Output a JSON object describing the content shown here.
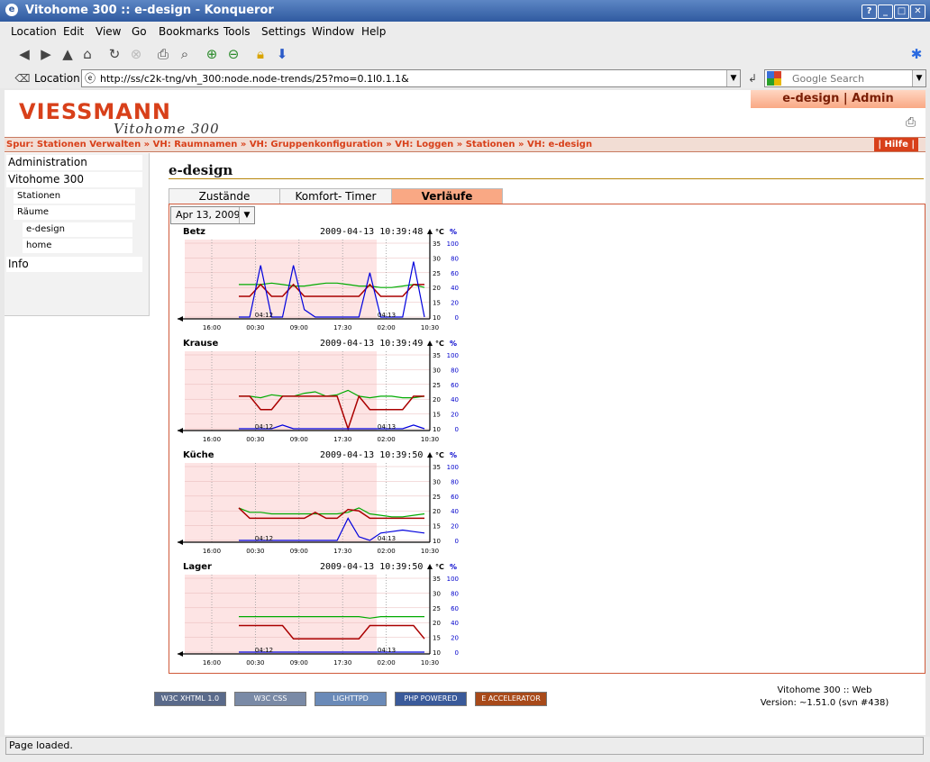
{
  "window": {
    "title": "Vitohome 300 :: e-design - Konqueror",
    "buttons": [
      "?",
      "_",
      "□",
      "✕"
    ]
  },
  "menu": [
    "Location",
    "Edit",
    "View",
    "Go",
    "Bookmarks",
    "Tools",
    "Settings",
    "Window",
    "Help"
  ],
  "location": {
    "label": "Location:",
    "url": "http://ss/c2k-tng/vh_300:node.node-trends/25?mo=0.1l0.1.1&",
    "search_placeholder": "Google Search"
  },
  "site": {
    "brand": "VIESSMANN",
    "product": "Vitohome 300",
    "user": "e-design | Admin",
    "breadcrumb": "Spur: Stationen Verwalten » VH: Raumnamen » VH: Gruppenkonfiguration » VH: Loggen » Stationen » VH: e-design",
    "help": "| Hilfe |"
  },
  "sidebar": {
    "items": [
      {
        "label": "Administration",
        "level": 0
      },
      {
        "label": "Vitohome 300",
        "level": 0
      },
      {
        "label": "Stationen",
        "level": 1
      },
      {
        "label": "Räume",
        "level": 1
      },
      {
        "label": "e-design",
        "level": 2
      },
      {
        "label": "home",
        "level": 2
      },
      {
        "label": "Info",
        "level": 0
      }
    ]
  },
  "content": {
    "title": "e-design",
    "tabs": [
      "Zustände",
      "Komfort- Timer",
      "Verläufe"
    ],
    "active_tab": 2,
    "date": "Apr 13, 2009"
  },
  "chart_data": [
    {
      "type": "line",
      "title": "Betz",
      "timestamp": "2009-04-13 10:39:48",
      "x_ticks": [
        "16:00",
        "00:30",
        "09:00",
        "17:30",
        "02:00",
        "10:30"
      ],
      "date_marks": [
        "04:12",
        "04:13"
      ],
      "y_left_unit": "°C",
      "y_left_ticks": [
        10,
        15,
        20,
        25,
        30,
        35
      ],
      "y_right_unit": "%",
      "y_right_ticks": [
        0,
        20,
        40,
        60,
        80,
        100
      ],
      "series": [
        {
          "color": "#00aa00",
          "values": [
            21,
            21,
            21,
            21.5,
            21,
            20.5,
            20.5,
            21,
            21.5,
            21.5,
            21,
            20.5,
            20.5,
            20,
            20,
            20.5,
            21,
            20
          ]
        },
        {
          "color": "#aa0000",
          "values": [
            17,
            17,
            21,
            17,
            17,
            21,
            17,
            17,
            17,
            17,
            17,
            17,
            21,
            17,
            17,
            17,
            21,
            21
          ]
        },
        {
          "color": "#0000dd",
          "values": [
            0,
            0,
            70,
            0,
            0,
            70,
            10,
            0,
            0,
            0,
            0,
            0,
            60,
            0,
            0,
            0,
            75,
            0
          ]
        }
      ]
    },
    {
      "type": "line",
      "title": "Krause",
      "timestamp": "2009-04-13 10:39:49",
      "x_ticks": [
        "16:00",
        "00:30",
        "09:00",
        "17:30",
        "02:00",
        "10:30"
      ],
      "date_marks": [
        "04:12",
        "04:13"
      ],
      "y_left_unit": "°C",
      "y_left_ticks": [
        10,
        15,
        20,
        25,
        30,
        35
      ],
      "y_right_unit": "%",
      "y_right_ticks": [
        0,
        20,
        40,
        60,
        80,
        100
      ],
      "series": [
        {
          "color": "#00aa00",
          "values": [
            21,
            21,
            20.5,
            21.5,
            21,
            21,
            22,
            22.5,
            21,
            21.5,
            23,
            21,
            20.5,
            21,
            21,
            20.5,
            20.5,
            21
          ]
        },
        {
          "color": "#aa0000",
          "values": [
            21,
            21,
            16.5,
            16.5,
            21,
            21,
            21,
            21,
            21,
            21,
            10,
            21,
            16.5,
            16.5,
            16.5,
            16.5,
            21,
            21
          ]
        },
        {
          "color": "#0000dd",
          "values": [
            0,
            0,
            0,
            0,
            5,
            0,
            0,
            0,
            0,
            0,
            0,
            0,
            0,
            0,
            0,
            0,
            5,
            0
          ]
        }
      ]
    },
    {
      "type": "line",
      "title": "Küche",
      "timestamp": "2009-04-13 10:39:50",
      "x_ticks": [
        "16:00",
        "00:30",
        "09:00",
        "17:30",
        "02:00",
        "10:30"
      ],
      "date_marks": [
        "04:12",
        "04:13"
      ],
      "y_left_unit": "°C",
      "y_left_ticks": [
        10,
        15,
        20,
        25,
        30,
        35
      ],
      "y_right_unit": "%",
      "y_right_ticks": [
        0,
        20,
        40,
        60,
        80,
        100
      ],
      "series": [
        {
          "color": "#00aa00",
          "values": [
            21,
            19.5,
            19.5,
            19,
            19,
            19,
            19,
            19,
            19,
            19,
            19.5,
            21,
            19,
            18.5,
            18,
            18,
            18.5,
            19
          ]
        },
        {
          "color": "#aa0000",
          "values": [
            21,
            17.5,
            17.5,
            17.5,
            17.5,
            17.5,
            17.5,
            19.5,
            17.5,
            17.5,
            20.5,
            20,
            17.5,
            17.5,
            17.5,
            17.5,
            17.5,
            17.5
          ]
        },
        {
          "color": "#0000dd",
          "values": [
            0,
            0,
            0,
            0,
            0,
            0,
            0,
            0,
            0,
            0,
            30,
            5,
            0,
            10,
            12,
            14,
            12,
            10
          ]
        }
      ]
    },
    {
      "type": "line",
      "title": "Lager",
      "timestamp": "2009-04-13 10:39:50",
      "x_ticks": [
        "16:00",
        "00:30",
        "09:00",
        "17:30",
        "02:00",
        "10:30"
      ],
      "date_marks": [
        "04:12",
        "04:13"
      ],
      "y_left_unit": "°C",
      "y_left_ticks": [
        10,
        15,
        20,
        25,
        30,
        35
      ],
      "y_right_unit": "%",
      "y_right_ticks": [
        0,
        20,
        40,
        60,
        80,
        100
      ],
      "series": [
        {
          "color": "#00aa00",
          "values": [
            22,
            22,
            22,
            22,
            22,
            22,
            22,
            22,
            22,
            22,
            22,
            22,
            21.5,
            22,
            22,
            22,
            22,
            22
          ]
        },
        {
          "color": "#aa0000",
          "values": [
            19,
            19,
            19,
            19,
            19,
            14.5,
            14.5,
            14.5,
            14.5,
            14.5,
            14.5,
            14.5,
            19,
            19,
            19,
            19,
            19,
            14.5
          ]
        },
        {
          "color": "#0000dd",
          "values": [
            0,
            0,
            0,
            0,
            0,
            0,
            0,
            0,
            0,
            0,
            0,
            0,
            0,
            0,
            0,
            0,
            0,
            0
          ]
        }
      ]
    }
  ],
  "footer": {
    "badges": [
      "W3C XHTML 1.0",
      "W3C CSS",
      "LIGHTTPD",
      "PHP POWERED",
      "E ACCELERATOR"
    ],
    "app": "Vitohome 300 :: Web",
    "version": "Version: ~1.51.0 (svn #438)"
  },
  "status": "Page loaded."
}
